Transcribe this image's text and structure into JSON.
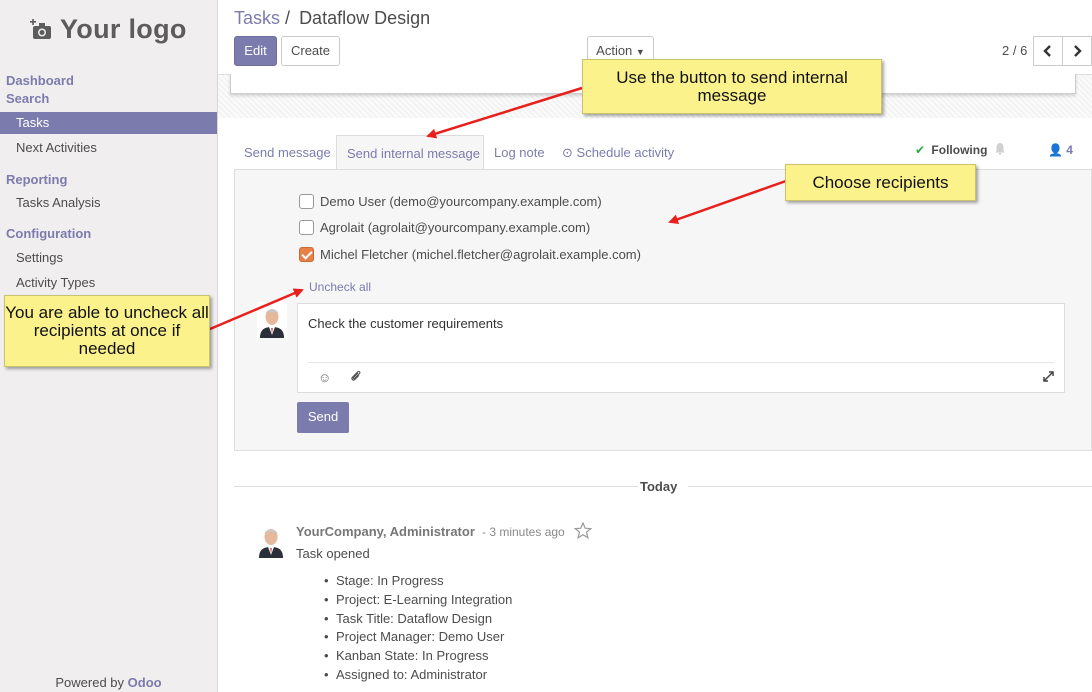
{
  "sidebar": {
    "logo_text": "Your logo",
    "sections": {
      "dashboard": "Dashboard",
      "search": "Search",
      "reporting": "Reporting",
      "configuration": "Configuration"
    },
    "items": {
      "tasks": "Tasks",
      "next_activities": "Next Activities",
      "tasks_analysis": "Tasks Analysis",
      "settings": "Settings",
      "activity_types": "Activity Types"
    },
    "active_item": "tasks",
    "powered_by": "Powered by",
    "powered_brand": "Odoo"
  },
  "header": {
    "breadcrumb_parent": "Tasks",
    "breadcrumb_sep": "/",
    "breadcrumb_current": "Dataflow Design",
    "edit_label": "Edit",
    "create_label": "Create",
    "action_label": "Action",
    "pager": "2 / 6"
  },
  "chatter": {
    "tabs": {
      "send_message": "Send message",
      "send_internal": "Send internal message",
      "log_note": "Log note",
      "schedule_activity": "Schedule activity"
    },
    "active_tab": "send_internal",
    "following_label": "Following",
    "followers_count": "4"
  },
  "composer": {
    "recipients": [
      {
        "label": "Demo User (demo@yourcompany.example.com)",
        "checked": false
      },
      {
        "label": "Agrolait (agrolait@yourcompany.example.com)",
        "checked": false
      },
      {
        "label": "Michel Fletcher (michel.fletcher@agrolait.example.com)",
        "checked": true
      }
    ],
    "uncheck_all": "Uncheck all",
    "message_text": "Check the customer requirements",
    "send_label": "Send"
  },
  "thread": {
    "date_separator": "Today",
    "author": "YourCompany, Administrator",
    "time": "- 3 minutes ago",
    "body": "Task opened",
    "tracking": [
      "Stage: In Progress",
      "Project: E-Learning Integration",
      "Task Title: Dataflow Design",
      "Project Manager: Demo User",
      "Kanban State: In Progress",
      "Assigned to: Administrator"
    ]
  },
  "callouts": {
    "internal_message": "Use the button to send internal message",
    "recipients": "Choose recipients",
    "uncheck": "You are able to uncheck all recipients at once if needed"
  },
  "colors": {
    "brand": "#7c7bad",
    "callout_bg": "#fbf28c",
    "arrow": "#e8201c",
    "checkbox_checked": "#e8804a"
  }
}
